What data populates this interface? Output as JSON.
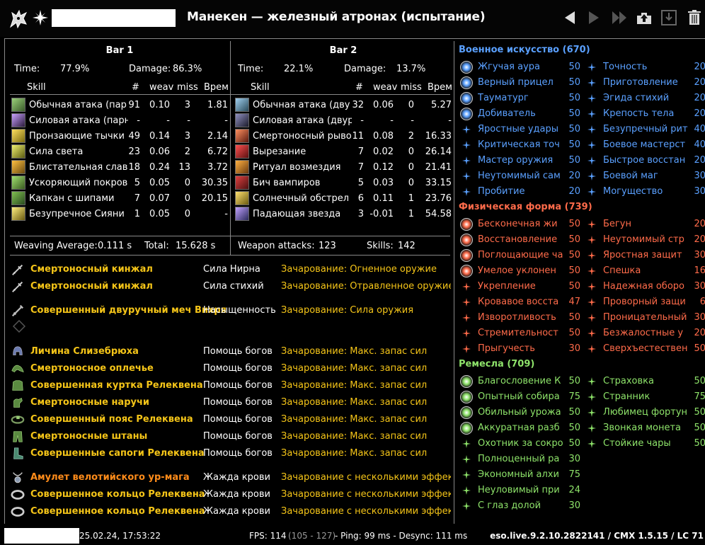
{
  "header": {
    "title": "Манекен — железный атронах (испытание)"
  },
  "bars": [
    {
      "title": "Bar 1",
      "time_label": "Time:",
      "time": "77.9%",
      "damage_label": "Damage:",
      "damage": "86.3%",
      "cols": [
        "Skill",
        "#",
        "weav",
        "miss",
        "Врем"
      ],
      "rows": [
        {
          "name": "Обычная атака (пар",
          "n": "91",
          "weav": "0.10",
          "miss": "3",
          "t": "1.81"
        },
        {
          "name": "Силовая атака (парн",
          "n": "-",
          "weav": "-",
          "miss": "-",
          "t": "-"
        },
        {
          "name": "Пронзающие тычки",
          "n": "49",
          "weav": "0.14",
          "miss": "3",
          "t": "2.14"
        },
        {
          "name": "Сила света",
          "n": "23",
          "weav": "0.06",
          "miss": "2",
          "t": "6.72"
        },
        {
          "name": "Блистательная слав",
          "n": "18",
          "weav": "0.24",
          "miss": "13",
          "t": "3.72"
        },
        {
          "name": "Ускоряющий покров",
          "n": "5",
          "weav": "0.05",
          "miss": "0",
          "t": "30.35"
        },
        {
          "name": "Капкан с шипами",
          "n": "7",
          "weav": "0.07",
          "miss": "0",
          "t": "20.15"
        },
        {
          "name": "Безупречное Сияни",
          "n": "1",
          "weav": "0.05",
          "miss": "0",
          "t": "-"
        }
      ],
      "footer_left_label": "Weaving Average:",
      "footer_left": "0.111 s",
      "footer_right_label": "Total:",
      "footer_right": "15.628 s"
    },
    {
      "title": "Bar 2",
      "time_label": "Time:",
      "time": "22.1%",
      "damage_label": "Damage:",
      "damage": "13.7%",
      "cols": [
        "Skill",
        "#",
        "weav",
        "miss",
        "Врем"
      ],
      "rows": [
        {
          "name": "Обычная атака (дву",
          "n": "32",
          "weav": "0.06",
          "miss": "0",
          "t": "5.27"
        },
        {
          "name": "Силовая атака (двур",
          "n": "-",
          "weav": "-",
          "miss": "-",
          "t": "-"
        },
        {
          "name": "Смертоносный рыво",
          "n": "11",
          "weav": "0.08",
          "miss": "2",
          "t": "16.33"
        },
        {
          "name": "Вырезание",
          "n": "7",
          "weav": "0.02",
          "miss": "0",
          "t": "26.14"
        },
        {
          "name": "Ритуал возмездия",
          "n": "7",
          "weav": "0.12",
          "miss": "0",
          "t": "21.41"
        },
        {
          "name": "Бич вампиров",
          "n": "5",
          "weav": "0.03",
          "miss": "0",
          "t": "33.15"
        },
        {
          "name": "Солнечный обстрел",
          "n": "6",
          "weav": "0.11",
          "miss": "1",
          "t": "23.76"
        },
        {
          "name": "Падающая звезда",
          "n": "3",
          "weav": "-0.01",
          "miss": "1",
          "t": "54.58"
        }
      ],
      "footer_left_label": "Weapon attacks:",
      "footer_left": "123",
      "footer_right_label": "Skills:",
      "footer_right": "142"
    }
  ],
  "gear": [
    {
      "name": "Смертоносный кинжал",
      "set": "Сила Нирна",
      "ench": "Зачарование: Огненное оружие",
      "icon": "dagger-icon",
      "color": "#f5c518"
    },
    {
      "name": "Смертоносный кинжал",
      "set": "Сила стихий",
      "ench": "Зачарование: Отравленное оружие",
      "icon": "dagger-icon",
      "color": "#f5c518"
    },
    {
      "name": "Совершенный двуручный меч Вихря",
      "set": "Насыщенность",
      "ench": "Зачарование: Сила оружия",
      "icon": "greatsword-icon",
      "color": "#f5c518"
    },
    {
      "name": "Личина Слизебрюха",
      "set": "Помощь богов",
      "ench": "Зачарование: Макс. запас сил",
      "icon": "helmet-icon",
      "color": "#f5c518"
    },
    {
      "name": "Смертоносное оплечье",
      "set": "Помощь богов",
      "ench": "Зачарование: Макс. запас сил",
      "icon": "shoulder-icon",
      "color": "#f5c518"
    },
    {
      "name": "Совершенная куртка Релеквена",
      "set": "Помощь богов",
      "ench": "Зачарование: Макс. запас сил",
      "icon": "chest-icon",
      "color": "#f5c518"
    },
    {
      "name": "Смертоносные наручи",
      "set": "Помощь богов",
      "ench": "Зачарование: Макс. запас сил",
      "icon": "gloves-icon",
      "color": "#f5c518"
    },
    {
      "name": "Совершенный пояс Релеквена",
      "set": "Помощь богов",
      "ench": "Зачарование: Макс. запас сил",
      "icon": "belt-icon",
      "color": "#f5c518"
    },
    {
      "name": "Смертоносные штаны",
      "set": "Помощь богов",
      "ench": "Зачарование: Макс. запас сил",
      "icon": "legs-icon",
      "color": "#f5c518"
    },
    {
      "name": "Совершенные сапоги Релеквена",
      "set": "Помощь богов",
      "ench": "Зачарование: Макс. запас сил",
      "icon": "boots-icon",
      "color": "#f5c518"
    },
    {
      "name": "Амулет велотийского ур-мага",
      "set": "Жажда крови",
      "ench": "Зачарование с несколькими эффек",
      "icon": "amulet-icon",
      "color": "#ff8c1a"
    },
    {
      "name": "Совершенное кольцо Релеквена",
      "set": "Жажда крови",
      "ench": "Зачарование с несколькими эффек",
      "icon": "ring-icon",
      "color": "#f5c518"
    },
    {
      "name": "Совершенное кольцо Релеквена",
      "set": "Жажда крови",
      "ench": "Зачарование с несколькими эффек",
      "icon": "ring-icon",
      "color": "#f5c518"
    }
  ],
  "cp": [
    {
      "title": "Военное искусство (670)",
      "color": "#5aa0ff",
      "left": [
        {
          "name": "Жгучая аура",
          "v": "50",
          "slotted": true
        },
        {
          "name": "Верный прицел",
          "v": "50",
          "slotted": true
        },
        {
          "name": "Тауматург",
          "v": "50",
          "slotted": true
        },
        {
          "name": "Добиватель",
          "v": "50",
          "slotted": true
        },
        {
          "name": "Яростные удары",
          "v": "50",
          "slotted": false
        },
        {
          "name": "Критическая точ",
          "v": "50",
          "slotted": false
        },
        {
          "name": "Мастер оружия",
          "v": "50",
          "slotted": false
        },
        {
          "name": "Неутомимый сам",
          "v": "20",
          "slotted": false
        },
        {
          "name": "Пробитие",
          "v": "20",
          "slotted": false
        }
      ],
      "right": [
        {
          "name": "Точность",
          "v": "20"
        },
        {
          "name": "Приготовление",
          "v": "20"
        },
        {
          "name": "Эгида стихий",
          "v": "20"
        },
        {
          "name": "Крепость тела",
          "v": "20"
        },
        {
          "name": "Безупречный рит",
          "v": "40"
        },
        {
          "name": "Боевое мастерст",
          "v": "40"
        },
        {
          "name": "Быстрое восстан",
          "v": "20"
        },
        {
          "name": "Боевой маг",
          "v": "30"
        },
        {
          "name": "Могущество",
          "v": "30"
        }
      ]
    },
    {
      "title": "Физическая форма (739)",
      "color": "#ff6b4a",
      "left": [
        {
          "name": "Бесконечная жи",
          "v": "50",
          "slotted": true
        },
        {
          "name": "Восстановление",
          "v": "50",
          "slotted": true
        },
        {
          "name": "Поглощающие ча",
          "v": "50",
          "slotted": true
        },
        {
          "name": "Умелое уклонен",
          "v": "50",
          "slotted": true
        },
        {
          "name": "Укрепление",
          "v": "50",
          "slotted": false
        },
        {
          "name": "Кровавое восста",
          "v": "47",
          "slotted": false
        },
        {
          "name": "Изворотливость",
          "v": "50",
          "slotted": false
        },
        {
          "name": "Стремительност",
          "v": "50",
          "slotted": false
        },
        {
          "name": "Прыгучесть",
          "v": "30",
          "slotted": false
        }
      ],
      "right": [
        {
          "name": "Бегун",
          "v": "20"
        },
        {
          "name": "Неутомимый стр",
          "v": "20"
        },
        {
          "name": "Яростная защит",
          "v": "30"
        },
        {
          "name": "Спешка",
          "v": "16"
        },
        {
          "name": "Надежная оборо",
          "v": "30"
        },
        {
          "name": "Проворный защи",
          "v": "6"
        },
        {
          "name": "Проницательный",
          "v": "30"
        },
        {
          "name": "Безжалостные у",
          "v": "20"
        },
        {
          "name": "Сверхъестествен",
          "v": "50"
        }
      ]
    },
    {
      "title": "Ремесла (709)",
      "color": "#8ee36a",
      "left": [
        {
          "name": "Благословение К",
          "v": "50",
          "slotted": true
        },
        {
          "name": "Опытный собира",
          "v": "75",
          "slotted": true
        },
        {
          "name": "Обильный урожа",
          "v": "50",
          "slotted": true
        },
        {
          "name": "Аккуратная разб",
          "v": "50",
          "slotted": true
        },
        {
          "name": "Охотник за сокро",
          "v": "50",
          "slotted": false
        },
        {
          "name": "Полноценный ра",
          "v": "30",
          "slotted": false
        },
        {
          "name": "Экономный алхи",
          "v": "75",
          "slotted": false
        },
        {
          "name": "Неуловимый при",
          "v": "24",
          "slotted": false
        },
        {
          "name": "С глаз долой",
          "v": "30",
          "slotted": false
        }
      ],
      "right": [
        {
          "name": "Страховка",
          "v": "50"
        },
        {
          "name": "Странник",
          "v": "75"
        },
        {
          "name": "Любимец фортун",
          "v": "50"
        },
        {
          "name": "Звонкая монета",
          "v": "50"
        },
        {
          "name": "Стойкие чары",
          "v": "50"
        }
      ]
    }
  ],
  "footer": {
    "datetime": "25.02.24, 17:53:22",
    "fps_label": "FPS: 114",
    "fps_range": "(105 - 127)",
    "ping": "- Ping: 99 ms - Desync: 111 ms",
    "version": "eso.live.9.2.10.2822141 / CMX 1.5.15 / LC 71"
  }
}
